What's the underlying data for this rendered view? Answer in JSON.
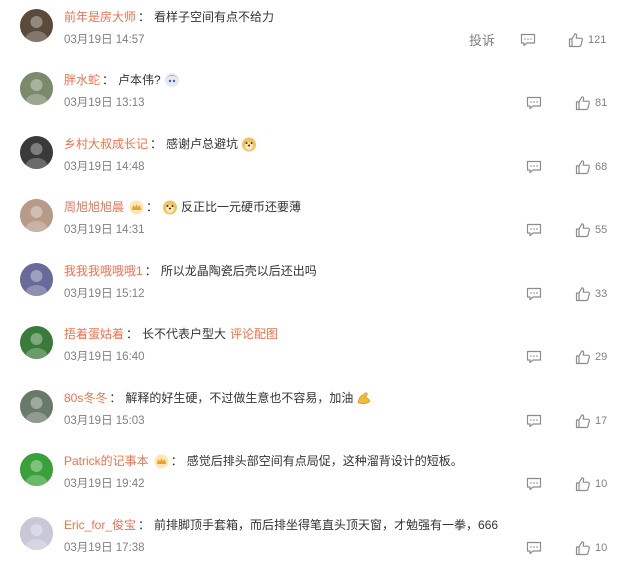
{
  "report_label": "投诉",
  "comments": [
    {
      "user": "前年是房大师",
      "content": "看样子空间有点不给力",
      "time": "03月19日 14:57",
      "likes": "121",
      "has_badge": false,
      "emoji": "",
      "link": ""
    },
    {
      "user": "胖水蛇",
      "content": "卢本伟?",
      "time": "03月19日 13:13",
      "likes": "81",
      "has_badge": false,
      "emoji": "anime-face",
      "link": ""
    },
    {
      "user": "乡村大叔成长记",
      "content": "感谢卢总避坑",
      "time": "03月19日 14:48",
      "likes": "68",
      "has_badge": false,
      "emoji": "doge",
      "link": ""
    },
    {
      "user": "周旭旭旭晨",
      "content": "反正比一元硬币还要薄",
      "time": "03月19日 14:31",
      "likes": "55",
      "has_badge": true,
      "emoji": "doge-before",
      "link": ""
    },
    {
      "user": "我我我哦哦哦1",
      "content": "所以龙晶陶瓷后壳以后还出吗",
      "time": "03月19日 15:12",
      "likes": "33",
      "has_badge": false,
      "emoji": "",
      "link": ""
    },
    {
      "user": "捂着蛋姑着",
      "content": "长不代表户型大",
      "time": "03月19日 16:40",
      "likes": "29",
      "has_badge": false,
      "emoji": "",
      "link": "评论配图"
    },
    {
      "user": "80s冬冬",
      "content": "解释的好生硬，不过做生意也不容易，加油",
      "time": "03月19日 15:03",
      "likes": "17",
      "has_badge": false,
      "emoji": "muscle",
      "link": ""
    },
    {
      "user": "Patrick的记事本",
      "content": "感觉后排头部空间有点局促，这种溜背设计的短板。",
      "time": "03月19日 19:42",
      "likes": "10",
      "has_badge": true,
      "emoji": "",
      "link": ""
    },
    {
      "user": "Eric_for_俊宝",
      "content": "前排脚顶手套箱，而后排坐得笔直头顶天窗，才勉强有一拳，666",
      "time": "03月19日 17:38",
      "likes": "10",
      "has_badge": false,
      "emoji": "",
      "link": ""
    }
  ],
  "colors": {
    "username": "#eb7350",
    "text": "#333333",
    "meta": "#808080"
  }
}
